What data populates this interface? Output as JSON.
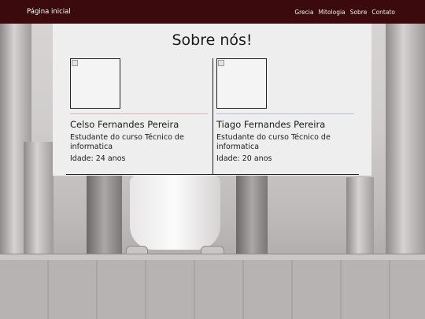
{
  "navbar": {
    "brand": "Página inicial",
    "links": [
      "Grecia",
      "Mitologia",
      "Sobre",
      "Contato"
    ]
  },
  "main": {
    "title": "Sobre nós!",
    "members": [
      {
        "name": "Celso Fernandes Pereira",
        "description": "Estudante do curso Técnico de informatica",
        "age": "Idade: 24 anos"
      },
      {
        "name": "Tiago Fernandes Pereira",
        "description": "Estudante do curso Técnico de informatica",
        "age": "Idade: 20 anos"
      }
    ]
  },
  "colors": {
    "navbar_bg": "#3a0a0d",
    "panel_bg": "#efeeee"
  }
}
